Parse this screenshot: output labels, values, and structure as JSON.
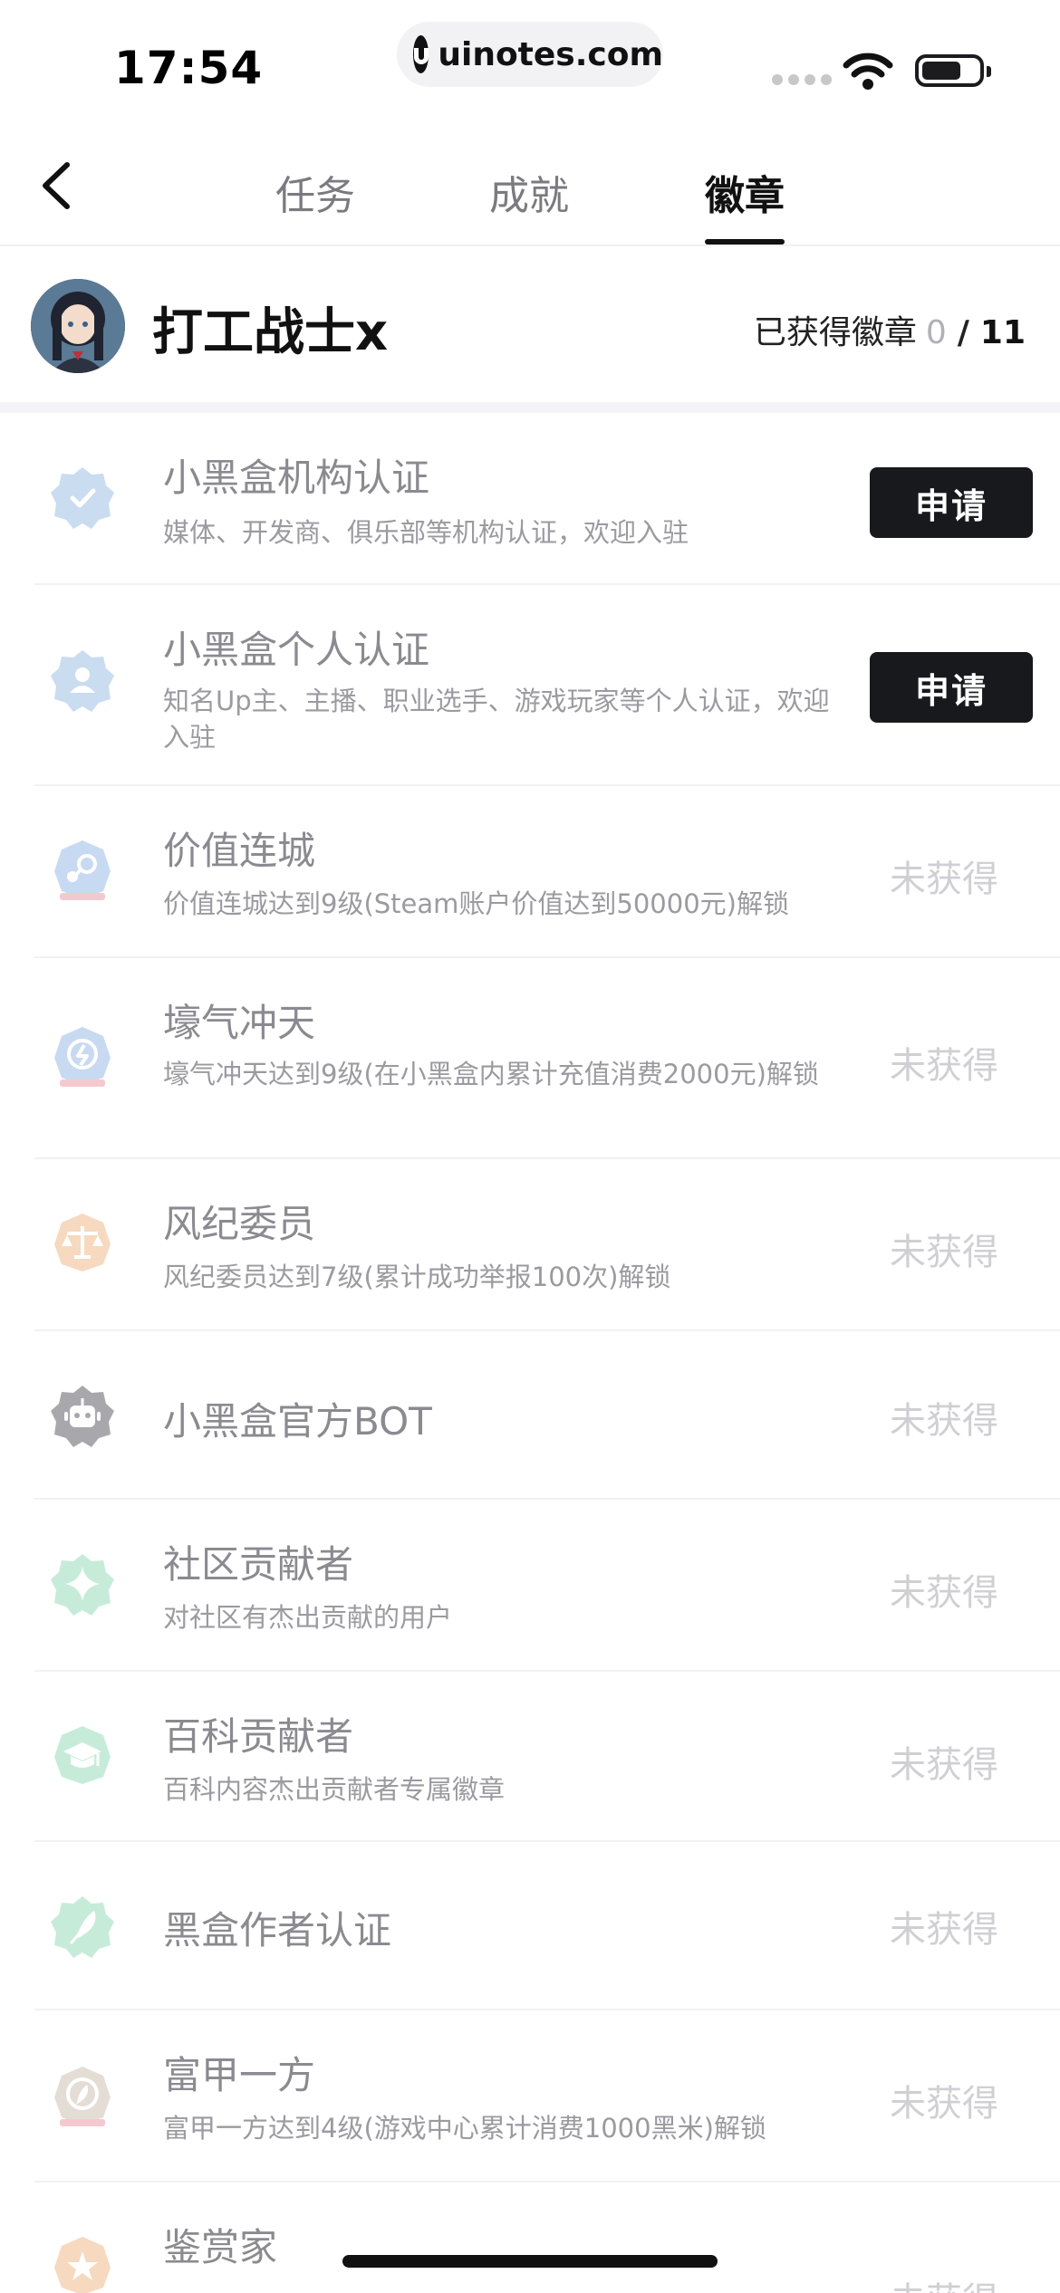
{
  "status_bar": {
    "time": "17:54",
    "url": "uinotes.com"
  },
  "nav": {
    "tabs": [
      {
        "label": "任务",
        "active": false
      },
      {
        "label": "成就",
        "active": false
      },
      {
        "label": "徽章",
        "active": true
      }
    ]
  },
  "profile": {
    "username": "打工战士x",
    "earned_label": "已获得徽章",
    "earned_count": "0",
    "separator": "/",
    "total_count": "11"
  },
  "badges": [
    {
      "title": "小黑盒机构认证",
      "desc": "媒体、开发商、俱乐部等机构认证，欢迎入驻",
      "action": "申请",
      "icon": "verified-check-icon",
      "color": "#c9dcf0"
    },
    {
      "title": "小黑盒个人认证",
      "desc": "知名Up主、主播、职业选手、游戏玩家等个人认证，欢迎入驻",
      "action": "申请",
      "icon": "person-verified-icon",
      "color": "#c9dcf0"
    },
    {
      "title": "价值连城",
      "desc": "价值连城达到9级(Steam账户价值达到50000元)解锁",
      "status": "未获得",
      "icon": "steam-value-icon",
      "color": "#c8daf2"
    },
    {
      "title": "壕气冲天",
      "desc": "壕气冲天达到9级(在小黑盒内累计充值消费2000元)解锁",
      "status": "未获得",
      "icon": "recharge-icon",
      "color": "#c8daf2"
    },
    {
      "title": "风纪委员",
      "desc": "风纪委员达到7级(累计成功举报100次)解锁",
      "status": "未获得",
      "icon": "justice-scale-icon",
      "color": "#f6d9bf"
    },
    {
      "title": "小黑盒官方BOT",
      "desc": "",
      "status": "未获得",
      "icon": "robot-icon",
      "color": "#a8a8ac"
    },
    {
      "title": "社区贡献者",
      "desc": "对社区有杰出贡献的用户",
      "status": "未获得",
      "icon": "star-sparkle-icon",
      "color": "#c6ecd9"
    },
    {
      "title": "百科贡献者",
      "desc": "百科内容杰出贡献者专属徽章",
      "status": "未获得",
      "icon": "graduation-cap-icon",
      "color": "#c6ecd9"
    },
    {
      "title": "黑盒作者认证",
      "desc": "",
      "status": "未获得",
      "icon": "feather-pen-icon",
      "color": "#c6ecd9"
    },
    {
      "title": "富甲一方",
      "desc": "富甲一方达到4级(游戏中心累计消费1000黑米)解锁",
      "status": "未获得",
      "icon": "wealth-coin-icon",
      "color": "#e4ddd6"
    },
    {
      "title": "鉴赏家",
      "desc": "",
      "status": "未获得",
      "icon": "connoisseur-icon",
      "color": "#f6d9bf"
    }
  ]
}
